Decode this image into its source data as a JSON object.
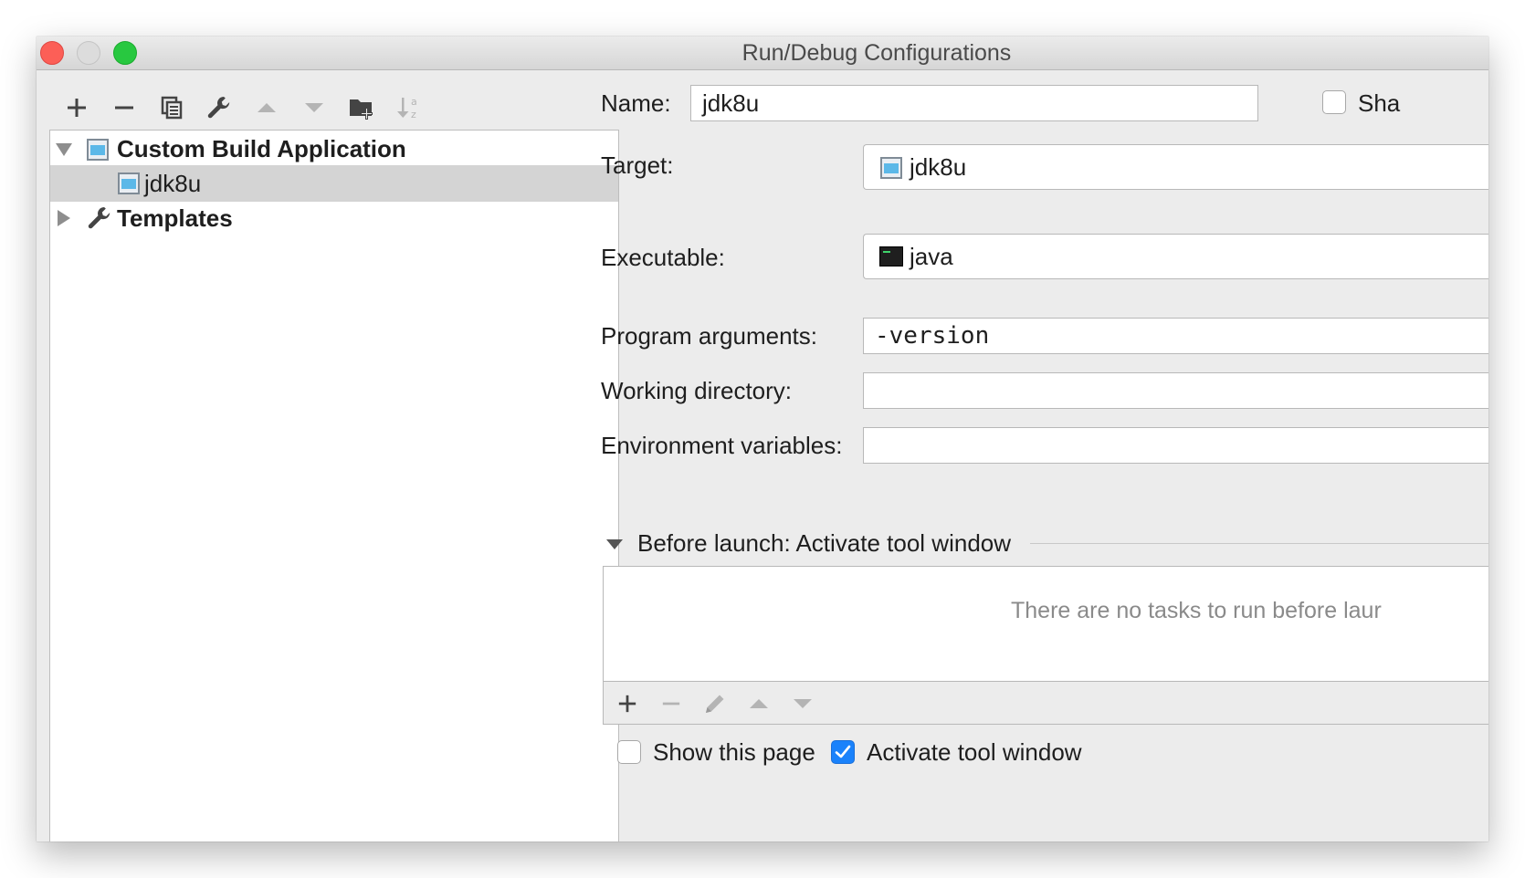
{
  "window": {
    "title": "Run/Debug Configurations"
  },
  "left_toolbar": {
    "icons": [
      "add-icon",
      "remove-icon",
      "copy-icon",
      "edit-templates-wrench-icon",
      "move-up-icon",
      "move-down-icon",
      "new-folder-icon",
      "sort-alphabetically-icon"
    ]
  },
  "tree": {
    "group_label": "Custom Build Application",
    "child_label": "jdk8u",
    "templates_label": "Templates"
  },
  "form": {
    "name_label": "Name:",
    "name_value": "jdk8u",
    "share_label": "Sha",
    "target_label": "Target:",
    "target_value": "jdk8u",
    "executable_label": "Executable:",
    "executable_value": "java",
    "program_args_label": "Program arguments:",
    "program_args_value": "-version",
    "working_dir_label": "Working directory:",
    "working_dir_value": "",
    "env_vars_label": "Environment variables:",
    "env_vars_value": ""
  },
  "before_launch": {
    "header": "Before launch: Activate tool window",
    "empty_text": "There are no tasks to run before laur",
    "toolbar_icons": [
      "add-icon",
      "remove-icon",
      "edit-pencil-icon",
      "move-up-icon",
      "move-down-icon"
    ]
  },
  "options": {
    "show_page_label": "Show this page",
    "show_page_checked": false,
    "activate_tool_label": "Activate tool window",
    "activate_tool_checked": true
  },
  "colors": {
    "accent": "#1a82fb",
    "selection": "#d4d4d4",
    "close": "#fc5f57",
    "maximize": "#28c840"
  }
}
